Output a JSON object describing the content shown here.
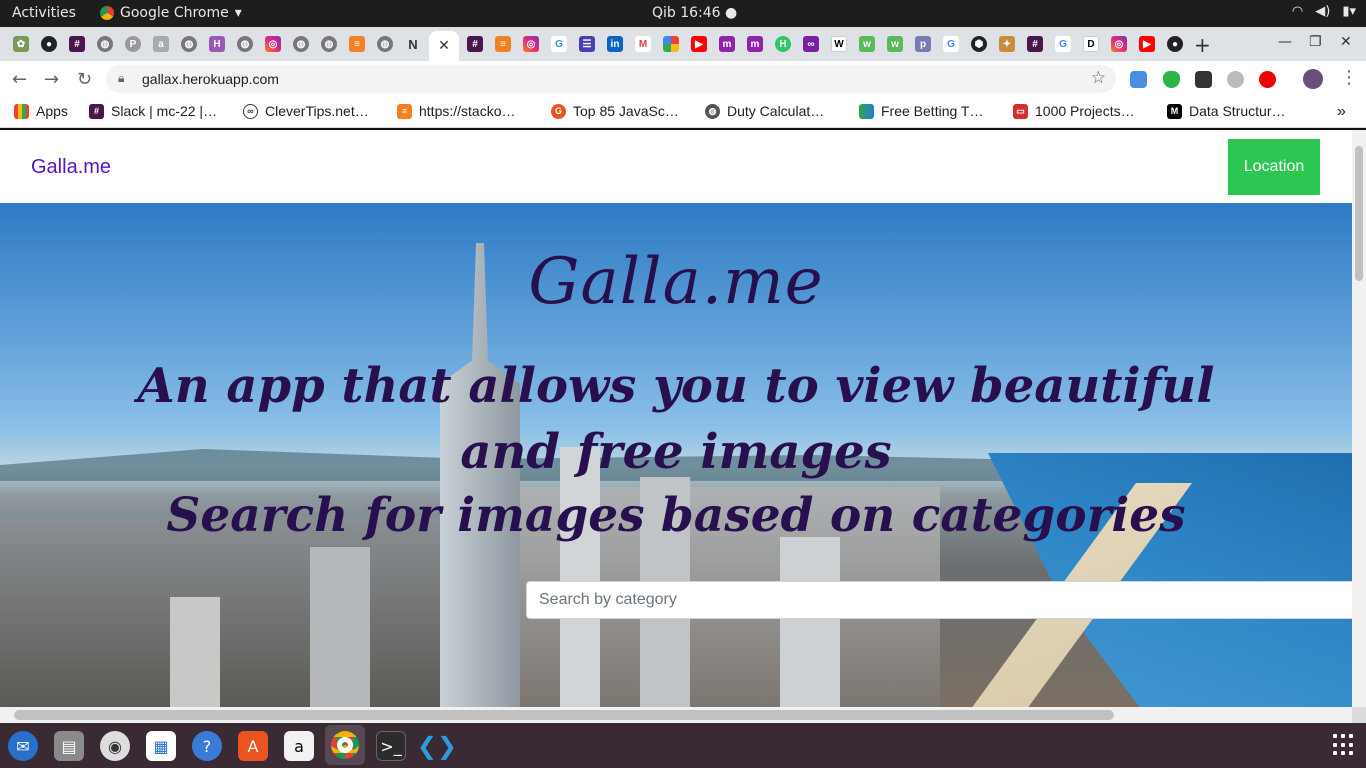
{
  "system": {
    "activities": "Activities",
    "app_name": "Google Chrome",
    "clock": "Qib 16:46 ●"
  },
  "browser": {
    "url": "gallax.herokuapp.com",
    "tab_letter": "N",
    "bookmarks": [
      {
        "label": "Apps",
        "icon": "apps-grid-icon"
      },
      {
        "label": "Slack | mc-22 |…",
        "icon": "slack-icon"
      },
      {
        "label": "CleverTips.net…",
        "icon": "clevertips-icon"
      },
      {
        "label": "https://stacko…",
        "icon": "stackoverflow-icon"
      },
      {
        "label": "Top 85 JavaSc…",
        "icon": "javascript-icon"
      },
      {
        "label": "Duty Calculat…",
        "icon": "globe-icon"
      },
      {
        "label": "Free Betting T…",
        "icon": "betting-icon"
      },
      {
        "label": "1000 Projects…",
        "icon": "projects-icon"
      },
      {
        "label": "Data Structur…",
        "icon": "medium-icon"
      }
    ],
    "more_bookmarks": "»"
  },
  "page": {
    "brand": "Galla.me",
    "location_button": "Location",
    "title": "Galla.me",
    "tagline": "An app that allows you to view beautiful and free images",
    "subline": "Search for images based on categories",
    "search_placeholder": "Search by category"
  },
  "colors": {
    "brand": "#5a12c4",
    "location_button": "#2dc653",
    "hero_text": "#28104e",
    "dock": "#3a2a33"
  }
}
